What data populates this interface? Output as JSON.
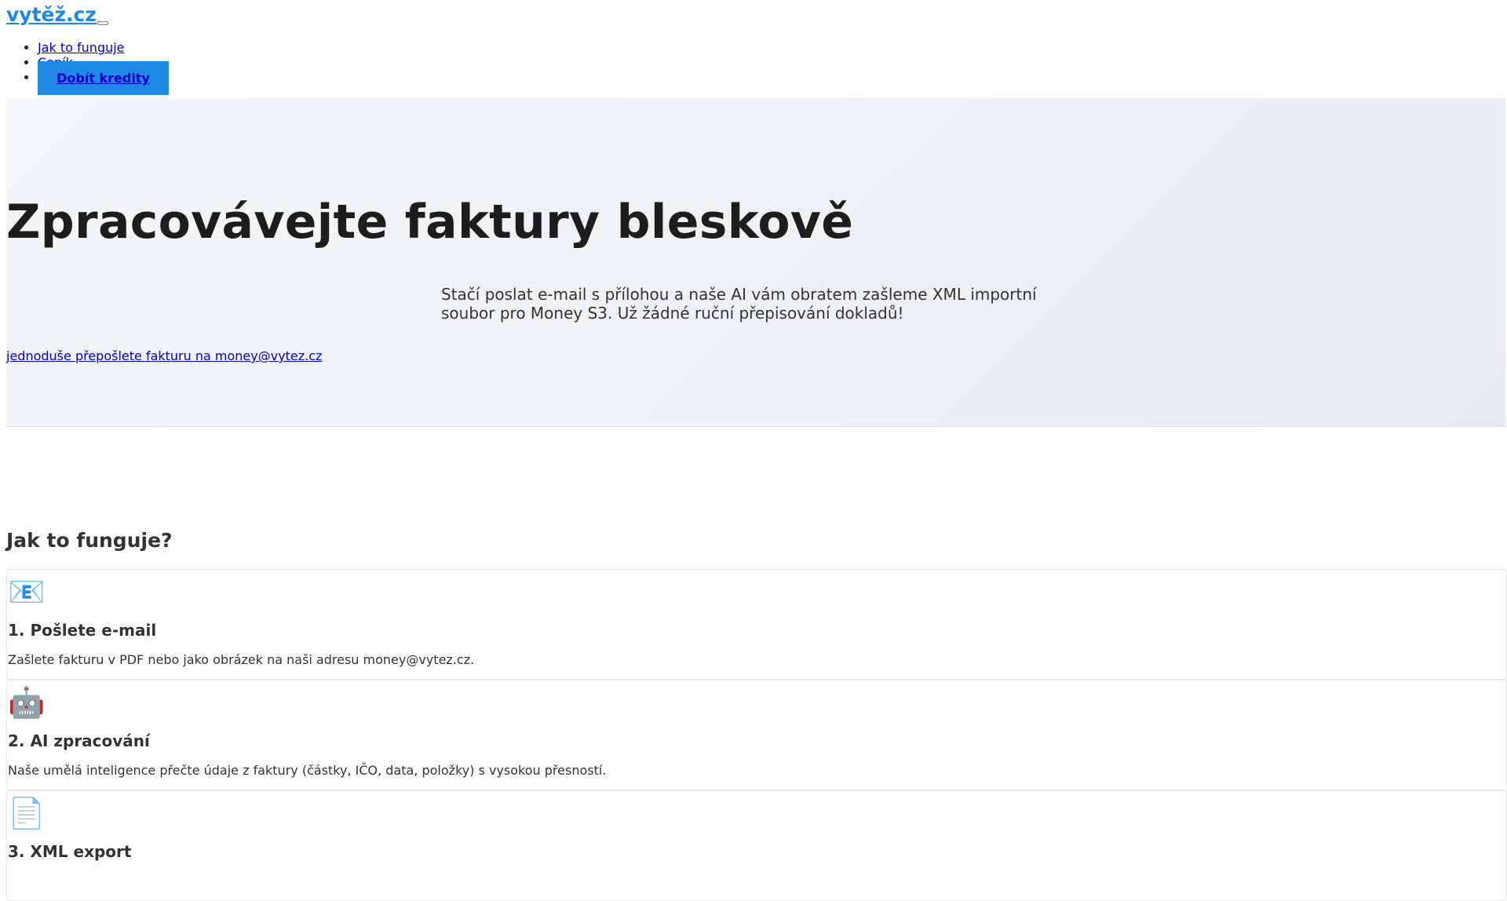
{
  "header": {
    "logo": "vytěž.cz",
    "nav": [
      "Jak to funguje",
      "Ceník"
    ],
    "cta": "Dobít kredity"
  },
  "hero": {
    "title": "Zpracovávejte faktury bleskově",
    "subtitle": "Stačí poslat e-mail s přílohou a naše AI vám obratem zašleme XML importní soubor pro Money S3. Už žádné ruční přepisování dokladů!",
    "link": "jednoduše přepošlete fakturu na money@vytez.cz"
  },
  "how": {
    "title": "Jak to funguje?",
    "steps": [
      {
        "icon": "📧",
        "title": "1. Pošlete e-mail",
        "text": "Zašlete fakturu v PDF nebo jako obrázek na naši adresu money@vytez.cz."
      },
      {
        "icon": "🤖",
        "title": "2. AI zpracování",
        "text": "Naše umělá inteligence přečte údaje z faktury (částky, IČO, data, položky) s vysokou přesností."
      },
      {
        "icon": "📄",
        "title": "3. XML export",
        "text": ""
      }
    ]
  }
}
